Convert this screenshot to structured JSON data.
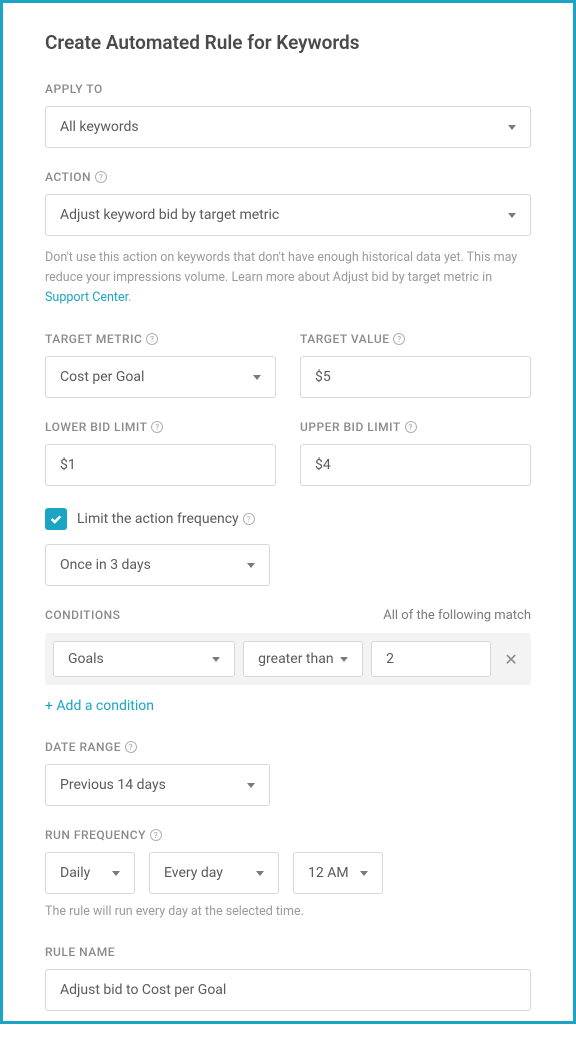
{
  "title": "Create Automated Rule for Keywords",
  "applyTo": {
    "label": "APPLY TO",
    "value": "All keywords"
  },
  "action": {
    "label": "ACTION",
    "value": "Adjust keyword bid by target metric",
    "hint_prefix": "Don't use this action on keywords that don't have enough historical data yet. This may reduce your impressions volume. Learn more about Adjust bid by target metric in ",
    "hint_link": "Support Center",
    "hint_suffix": "."
  },
  "targetMetric": {
    "label": "TARGET METRIC",
    "value": "Cost per Goal"
  },
  "targetValue": {
    "label": "TARGET VALUE",
    "value": "$5"
  },
  "lowerBid": {
    "label": "LOWER BID LIMIT",
    "value": "$1"
  },
  "upperBid": {
    "label": "UPPER BID LIMIT",
    "value": "$4"
  },
  "limitFrequency": {
    "checked": true,
    "label": "Limit the action frequency",
    "value": "Once in 3 days"
  },
  "conditions": {
    "label": "CONDITIONS",
    "sublabel": "All of the following match",
    "rows": [
      {
        "field": "Goals",
        "op": "greater than",
        "value": "2"
      }
    ],
    "addLabel": "+ Add a condition"
  },
  "dateRange": {
    "label": "DATE RANGE",
    "value": "Previous 14 days"
  },
  "runFrequency": {
    "label": "RUN FREQUENCY",
    "freq": "Daily",
    "day": "Every day",
    "time": "12 AM",
    "hint": "The rule will run every day at the selected time."
  },
  "ruleName": {
    "label": "RULE NAME",
    "value": "Adjust bid to Cost per Goal"
  }
}
